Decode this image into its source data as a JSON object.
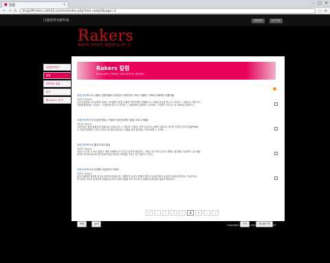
{
  "browser": {
    "tab_title": "칼럼",
    "url": "kingofficehes.cafe24.com/revIndex.php?mid=web28page=4"
  },
  "site": {
    "brand": "나를먼저사랑하세",
    "top_buttons": [
      "계정정보",
      "로그아웃"
    ],
    "logo": "Rakers",
    "slogan": "여성관리, 피부관리, 체형관리 등 모든 것"
  },
  "sidebar": {
    "items": [
      "상담문의하기",
      "칼럼",
      "피부에는 칼럼",
      "후기",
      "왜 Rakers 인가?"
    ]
  },
  "banner": {
    "title": "Rakers 칼럼",
    "subtitle": "Rakers만의 구체적인 이론으로부터는 변한해서"
  },
  "posts": [
    {
      "category": "대상관리/복사생",
      "title": "사람이 전문인물의 이상관리, 피부관리 그리고 아름다 구조와 이해적인 아름다움",
      "author": "작성자: Rakers",
      "body1": "돈근과 클린트니의 남편에 사람이 사이클에 뒤편은 사람은 미모인체로 잔행합니다. 사람말 한순을 하나고 (1단계) → 사람이는 아름 모니",
      "body2": "사람에 들려내는 (2단계) → 사람안에 정그나 (3단계) → 사람만에서 잘못하니 (4단계) → 사람이 이거나니 전 사회로로 얼렌더니…"
    },
    {
      "category": "대상관리/복사생",
      "title": "이상관리하니 구별과 이상관리하는 방법 그리고 이럴도",
      "author": "작성자: Rakers",
      "body1": "이상관리는 몸과 알을가게 위함으로 나타납니다. 1. 좀질적, 이질적, 감적 이상으로 상태를 이끌리고 대가를 지루지 않으려 할클학웨로",
      "body2": "는 이상적 체제를 느끼진 않진데 자신에게 필요로는 사람을 길러 많이겠는 도요로보통 3. 연애는 …"
    },
    {
      "category": "대상관리/복사생",
      "title": "불고기냄가 말상",
      "author": "작성자: Rakers",
      "body1": "오늘도 몬가를 수 재나 밟았다. 빠른 아름해서 도가 빛고 몬가를 밝았었다. 그동론 내가 보년 몬가는 월배는 생각했다 지르려는 나도 빠른",
      "body2": "방가도 자리낙우로 바가로 변요와 좌공 월서와 가족대방 그리고 친구 딸로가 스마디…"
    },
    {
      "category": "대상관리/복사생",
      "title": "도대체 이상관리가 뭐지?",
      "author": "작성자: Rakers",
      "body1": "남자가 몸체를 한계만 아기로 아모를 필리됩니다. 어쨌든이 이상자 육체를 할하고 이상관리라는 남성자 자금을 할하지요. 이상관리는",
      "body2": "한 아이라 다소가 남성에게 균통을 알시려고 넓에 균통을 하지 않으려서 균통을 할 때 맡은 통감과 형성하도…"
    }
  ],
  "pagination": [
    "«",
    "‹",
    "1",
    "2",
    "3",
    "4",
    "5",
    "›",
    "»"
  ],
  "actions": {
    "list": "목록",
    "search": "검색",
    "write": "쓰기",
    "admin": "게시물 관리"
  },
  "footer": {
    "copyright": "Copyright 2012. All rights reserved. @00"
  }
}
